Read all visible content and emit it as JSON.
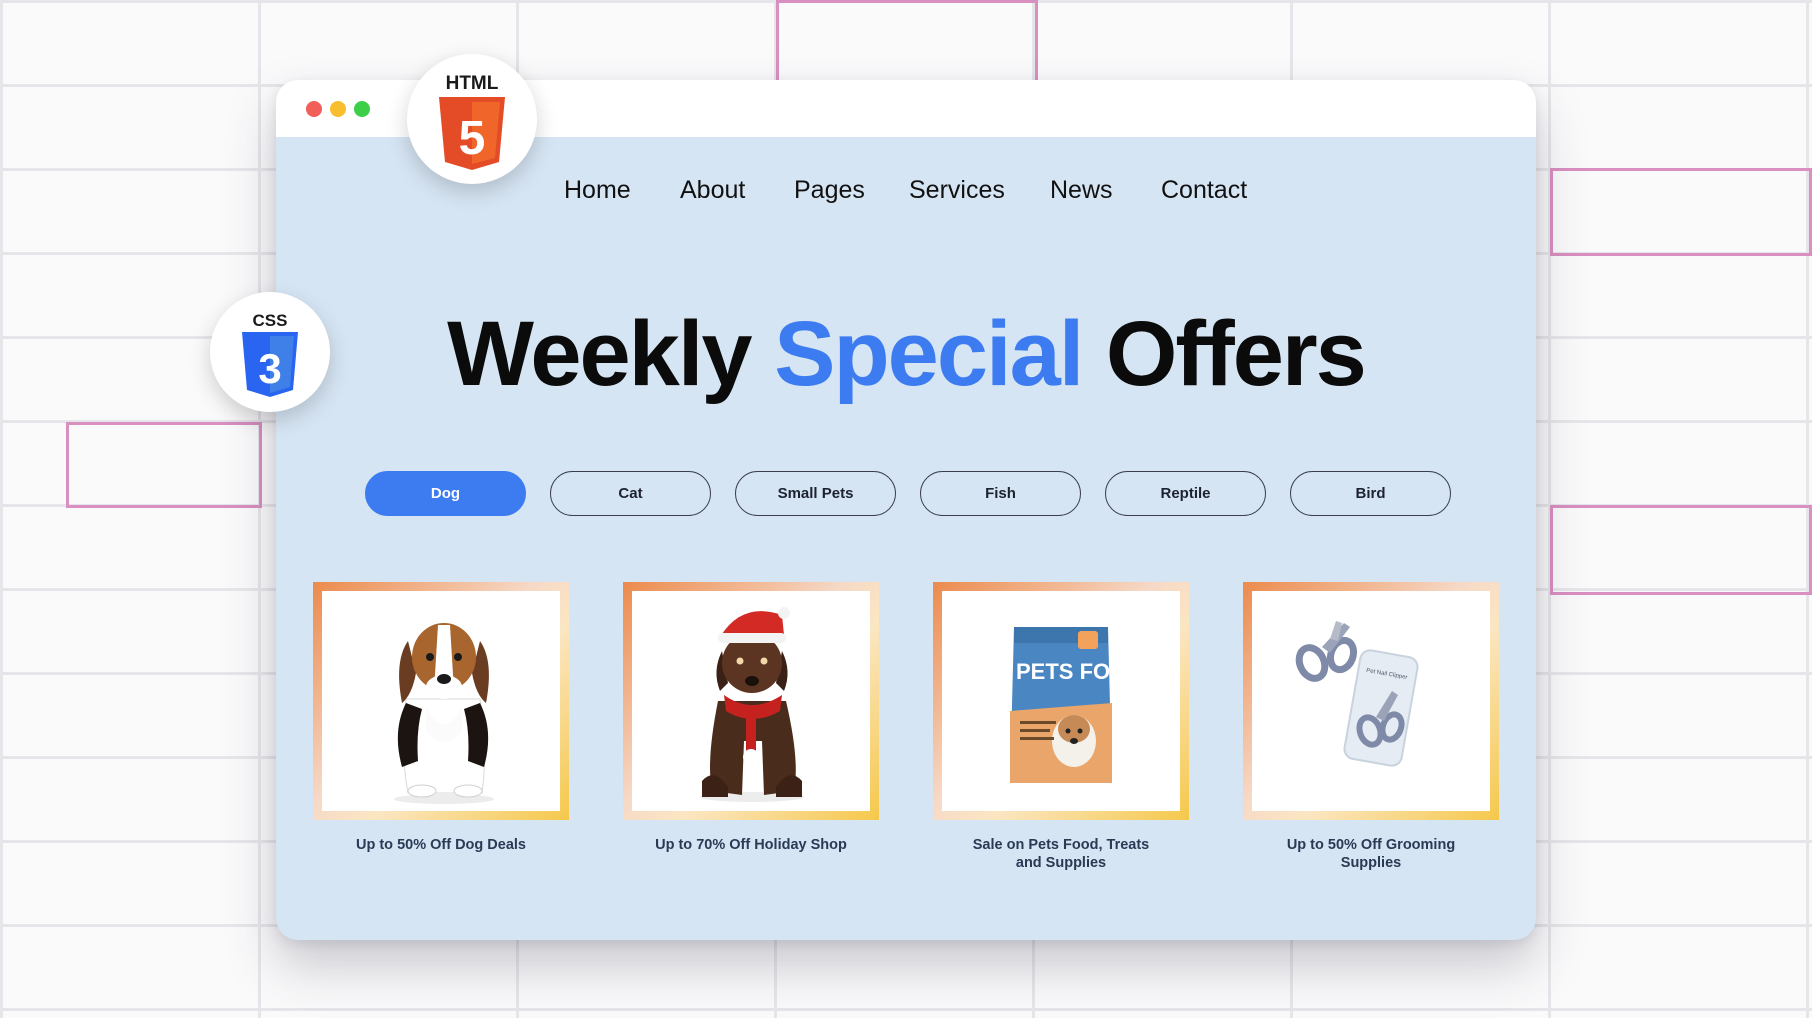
{
  "badges": {
    "html_label": "HTML",
    "html_number": "5",
    "css_label": "CSS",
    "css_number": "3"
  },
  "nav": [
    "Home",
    "About",
    "Pages",
    "Services",
    "News",
    "Contact"
  ],
  "headline": {
    "part1": "Weekly",
    "accent": "Special",
    "part2": "Offers"
  },
  "filters": [
    {
      "label": "Dog",
      "active": true
    },
    {
      "label": "Cat",
      "active": false
    },
    {
      "label": "Small Pets",
      "active": false
    },
    {
      "label": "Fish",
      "active": false
    },
    {
      "label": "Reptile",
      "active": false
    },
    {
      "label": "Bird",
      "active": false
    }
  ],
  "cards": [
    {
      "image": "beagle-puppy",
      "caption_lines": [
        "Up to 50% Off Dog Deals"
      ]
    },
    {
      "image": "puppy-in-santa-hat",
      "caption_lines": [
        "Up to 70% Off Holiday Shop"
      ]
    },
    {
      "image": "pet-food-bag",
      "caption_lines": [
        "Sale on Pets Food, Treats",
        "and Supplies"
      ],
      "bag_text": "PETS FOOD"
    },
    {
      "image": "nail-clipper",
      "caption_lines": [
        "Up to 50% Off Grooming",
        "Supplies"
      ],
      "package_text": "Pet Nail Clipper"
    }
  ],
  "colors": {
    "accent": "#3d7cf0",
    "window_bg": "#d6e5f4",
    "traffic_red": "#f25f58",
    "traffic_yellow": "#f9be2e",
    "traffic_green": "#3ecf4a",
    "html5_orange": "#e34c26",
    "css3_blue": "#2965f1"
  }
}
